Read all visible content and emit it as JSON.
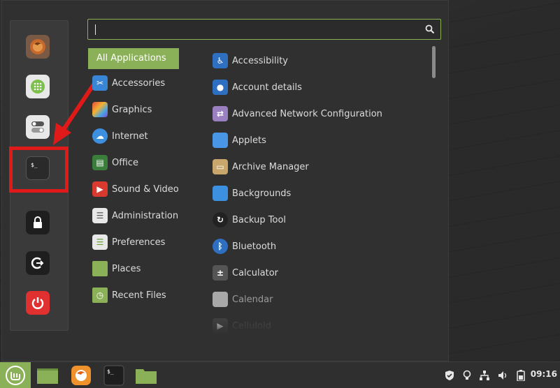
{
  "search": {
    "value": "",
    "placeholder": ""
  },
  "categories": {
    "selected": "All Applications",
    "items": [
      {
        "label": "Accessories"
      },
      {
        "label": "Graphics"
      },
      {
        "label": "Internet"
      },
      {
        "label": "Office"
      },
      {
        "label": "Sound & Video"
      },
      {
        "label": "Administration"
      },
      {
        "label": "Preferences"
      },
      {
        "label": "Places"
      },
      {
        "label": "Recent Files"
      }
    ]
  },
  "apps": [
    {
      "label": "Accessibility"
    },
    {
      "label": "Account details"
    },
    {
      "label": "Advanced Network Configuration"
    },
    {
      "label": "Applets"
    },
    {
      "label": "Archive Manager"
    },
    {
      "label": "Backgrounds"
    },
    {
      "label": "Backup Tool"
    },
    {
      "label": "Bluetooth"
    },
    {
      "label": "Calculator"
    },
    {
      "label": "Calendar"
    },
    {
      "label": "Celluloid"
    }
  ],
  "favorites": [
    "firefox-icon",
    "software-manager-icon",
    "settings-toggle-icon",
    "terminal-icon",
    "lock-screen-icon",
    "logout-icon",
    "shutdown-icon"
  ],
  "taskbar": {
    "clock": "09:16"
  },
  "colors": {
    "accent": "#8bb158",
    "highlight": "#e01919",
    "menu_bg": "#303030"
  }
}
